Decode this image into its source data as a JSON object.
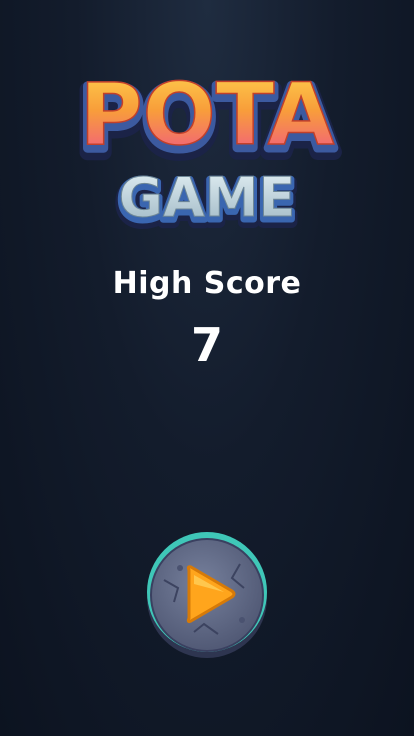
{
  "logo": {
    "line1": "POTA",
    "line2": "GAME"
  },
  "high_score": {
    "label": "High Score",
    "value": "7"
  },
  "play_button": {
    "icon": "play-icon"
  },
  "colors": {
    "background": "#131c2c",
    "logo_top_fill": "#f6a23a",
    "logo_bottom_fill": "#c7dde6",
    "logo_outline": "#24305a",
    "button_stone": "#5d6684",
    "button_rim": "#44d0c0",
    "play_triangle": "#ffa51c"
  }
}
